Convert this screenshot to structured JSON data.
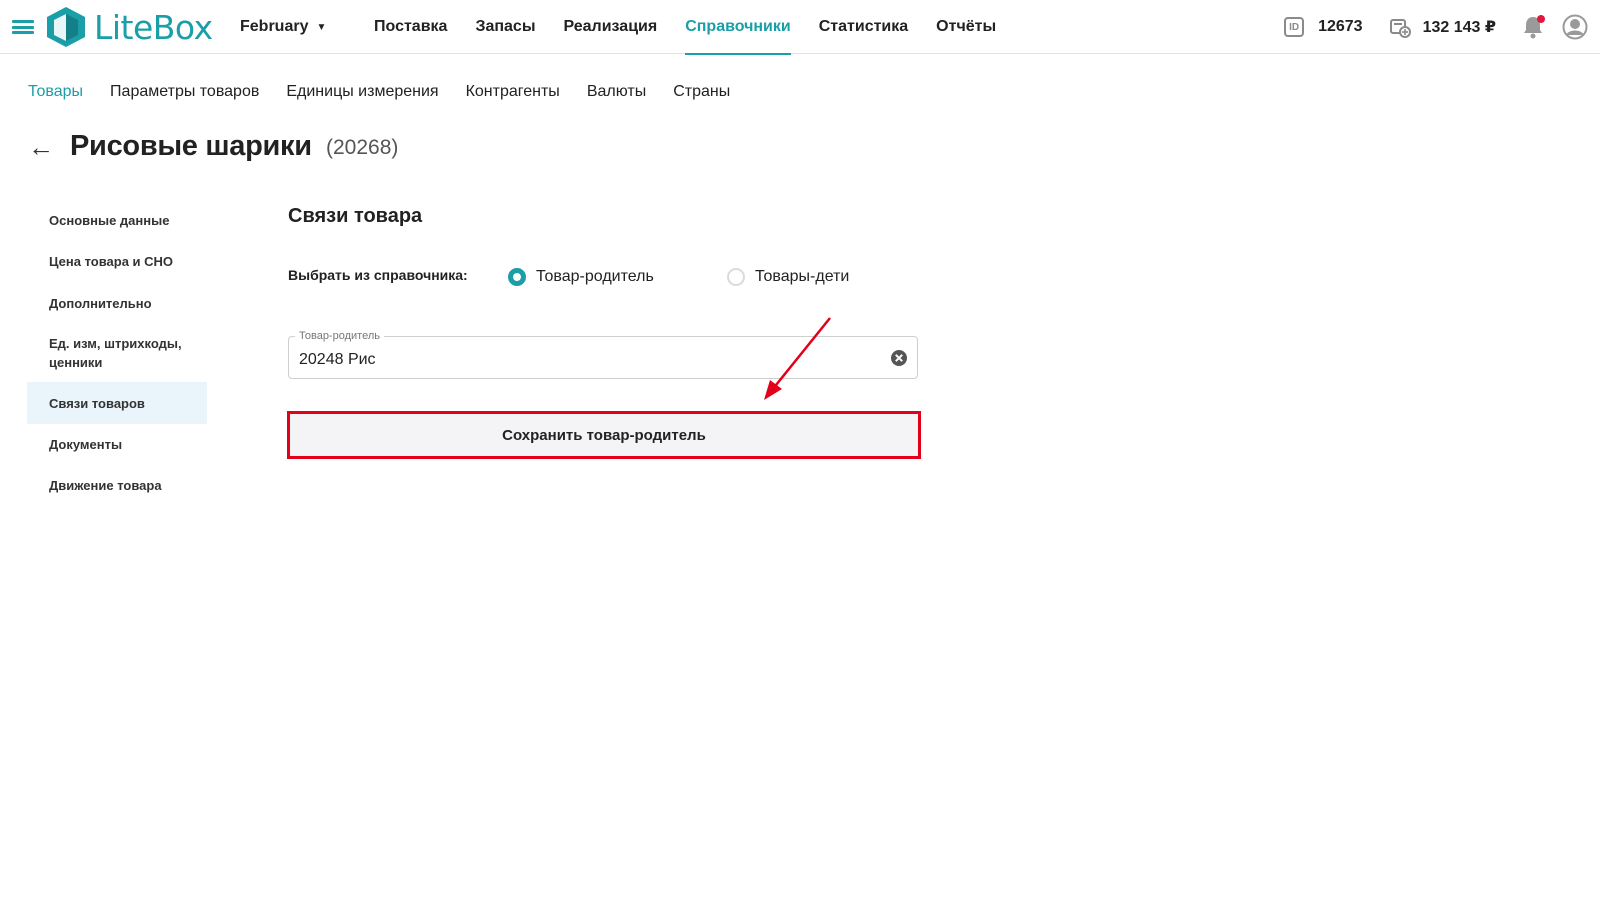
{
  "header": {
    "brand": "LiteBox",
    "month": "February",
    "nav": [
      "Поставка",
      "Запасы",
      "Реализация",
      "Справочники",
      "Статистика",
      "Отчёты"
    ],
    "active_nav_index": 3,
    "id_label": "ID",
    "account_id": "12673",
    "balance": "132 143 ₽",
    "colors": {
      "accent": "#1a9fa8",
      "notification": "#e3173e"
    }
  },
  "subnav": {
    "items": [
      "Товары",
      "Параметры товаров",
      "Единицы измерения",
      "Контрагенты",
      "Валюты",
      "Страны"
    ],
    "active_index": 0
  },
  "page": {
    "back_symbol": "←",
    "title": "Рисовые шарики",
    "code": "(20268)"
  },
  "sidemenu": {
    "items": [
      "Основные данные",
      "Цена товара и СНО",
      "Дополнительно",
      "Ед. изм, штрихкоды, ценники",
      "Связи товаров",
      "Документы",
      "Движение товара"
    ],
    "active_index": 4
  },
  "content": {
    "section_title": "Связи товара",
    "choose_label": "Выбрать из справочника:",
    "radio_parent": "Товар-родитель",
    "radio_children": "Товары-дети",
    "selected": "parent",
    "field_label": "Товар-родитель",
    "field_value": "20248 Рис",
    "save_button": "Сохранить товар-родитель",
    "annotation_color": "#e3001b"
  }
}
